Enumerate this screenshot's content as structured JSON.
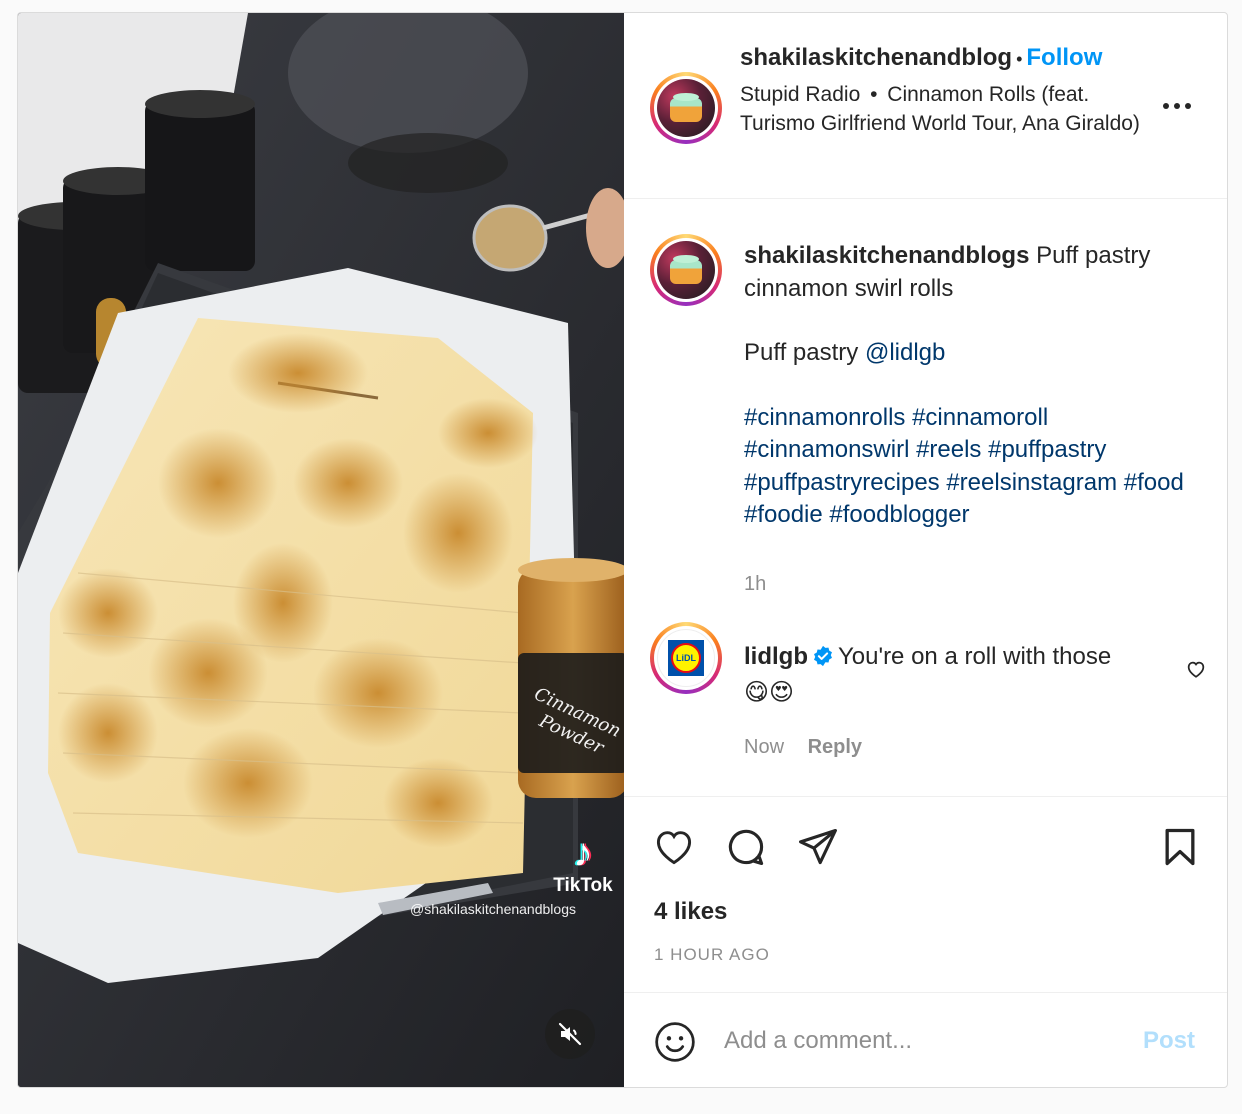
{
  "post": {
    "author": "shakilaskitchenandblog",
    "follow_label": "Follow",
    "separator": "•",
    "audio": {
      "artist": "Stupid Radio",
      "separator": "•",
      "track": "Cinnamon Rolls (feat. Turismo Girlfriend World Tour, Ana Giraldo)"
    },
    "more_icon": "more-horizontal-icon"
  },
  "media": {
    "tiktok_label": "TikTok",
    "tiktok_handle": "@shakilaskitchenandblogs",
    "jar_label_line1": "Cinnamon",
    "jar_label_line2": "Powder",
    "mute_icon": "speaker-muted-icon"
  },
  "caption": {
    "username": "shakilaskitchenandblogs",
    "text": "Puff pastry cinnamon swirl rolls",
    "line2_prefix": "Puff pastry",
    "mention": "@lidlgb",
    "hashtags": "#cinnamonrolls #cinnamoroll #cinnamonswirl #reels #puffpastry #puffpastryrecipes #reelsinstagram #food #foodie #foodblogger",
    "time": "1h"
  },
  "comment": {
    "username": "lidlgb",
    "text": "You're on a roll with those",
    "emojis": "😋😍",
    "time": "Now",
    "reply_label": "Reply",
    "avatar_text": "LiDL"
  },
  "actions": {
    "likes": "4 likes",
    "timestamp": "1 HOUR AGO"
  },
  "composer": {
    "placeholder": "Add a comment...",
    "post_label": "Post"
  },
  "colors": {
    "link_blue": "#0095f6",
    "hashtag": "#00376b",
    "muted_text": "#8e8e8e",
    "post_disabled": "#b2dffc"
  }
}
